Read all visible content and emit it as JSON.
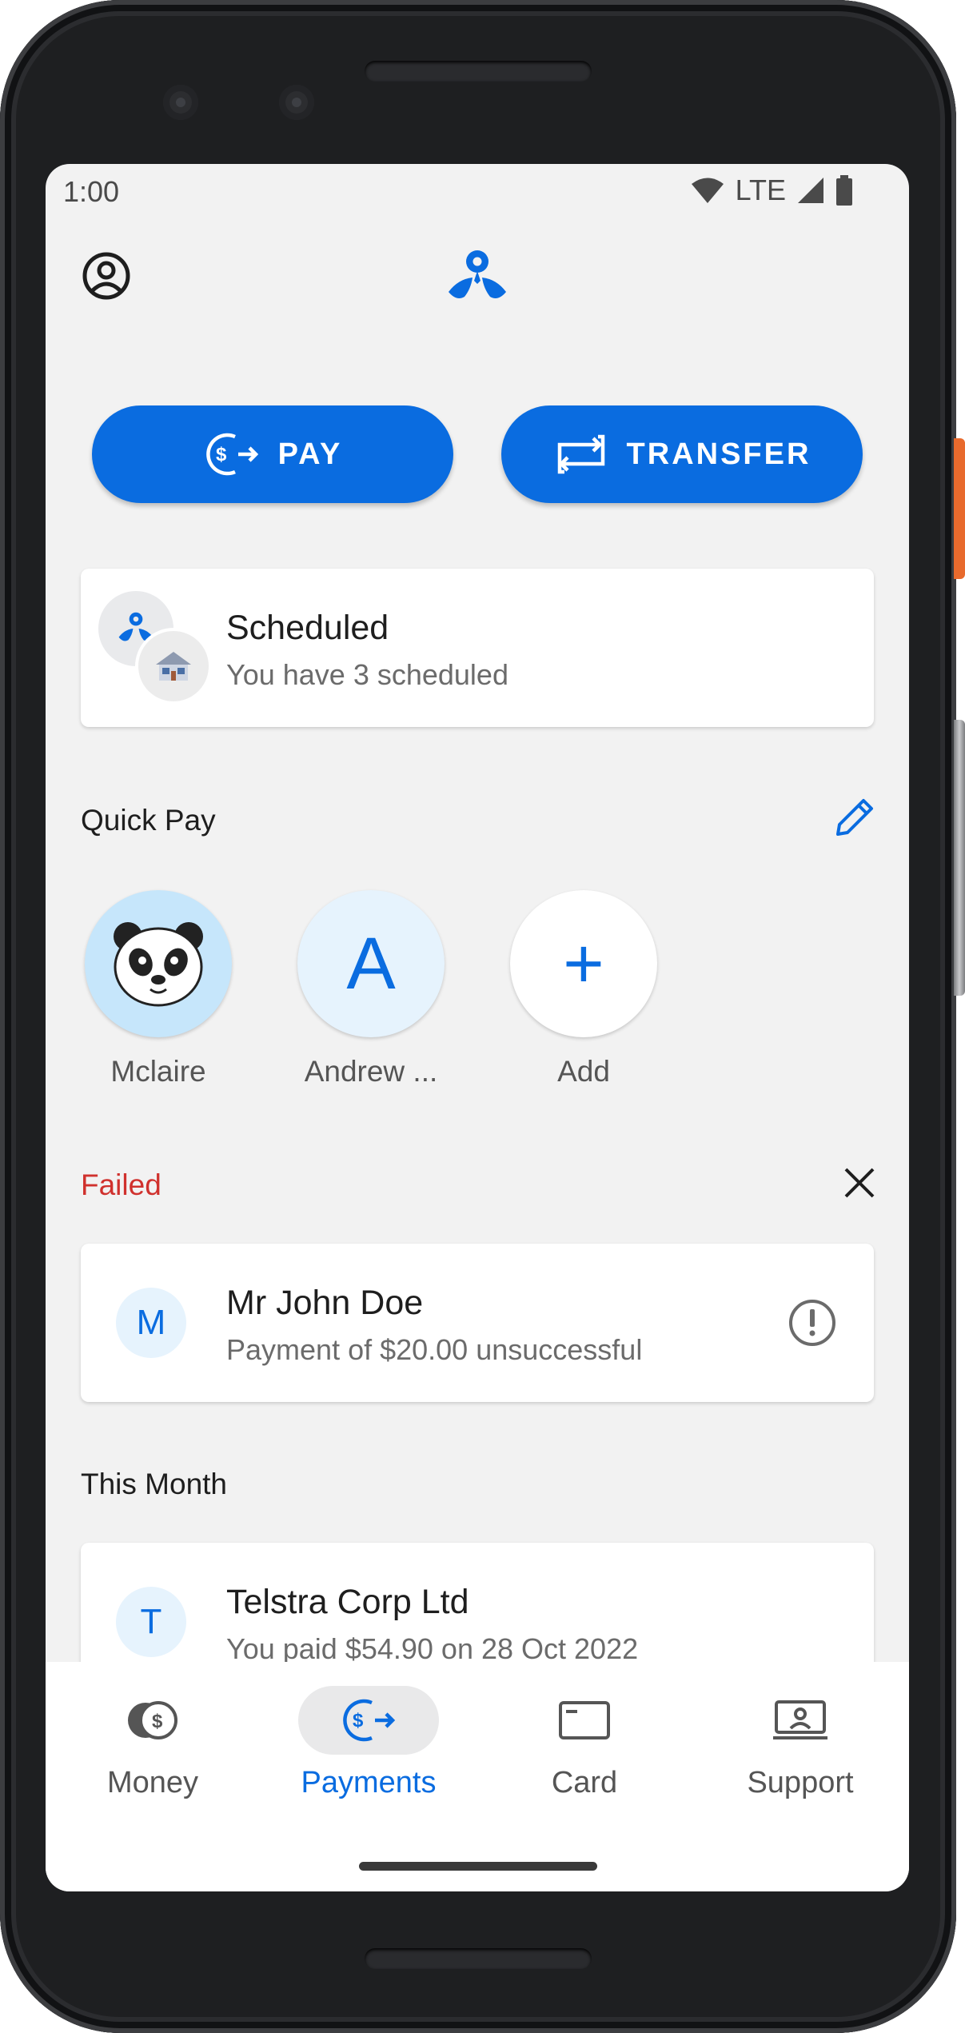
{
  "status_bar": {
    "time": "1:00",
    "network": "LTE",
    "icons": [
      "wifi-icon",
      "cell-signal-icon",
      "battery-icon"
    ]
  },
  "header": {
    "profile_icon": "account-circle-icon",
    "logo": "bank-logo"
  },
  "actions": {
    "pay_label": "PAY",
    "pay_icon": "payment-arrow-icon",
    "transfer_label": "TRANSFER",
    "transfer_icon": "transfer-arrows-icon"
  },
  "scheduled": {
    "title": "Scheduled",
    "subtitle": "You have 3 scheduled"
  },
  "quick_pay": {
    "title": "Quick Pay",
    "edit_icon": "pencil-icon",
    "items": [
      {
        "label": "Mclaire",
        "avatar": "🐼"
      },
      {
        "label": "Andrew ...",
        "avatar": "A"
      },
      {
        "label": "Add",
        "avatar": "+"
      }
    ]
  },
  "failed": {
    "title": "Failed",
    "close_icon": "close-icon",
    "items": [
      {
        "initial": "M",
        "name": "Mr John Doe",
        "detail": "Payment of $20.00 unsuccessful",
        "status_icon": "alert-circle-icon"
      }
    ]
  },
  "this_month": {
    "title": "This Month",
    "items": [
      {
        "initial": "T",
        "name": "Telstra Corp Ltd",
        "detail": "You paid $54.90 on 28 Oct 2022"
      }
    ]
  },
  "bottom_nav": {
    "items": [
      {
        "label": "Money",
        "icon": "money-icon",
        "active": false
      },
      {
        "label": "Payments",
        "icon": "payments-icon",
        "active": true
      },
      {
        "label": "Card",
        "icon": "card-icon",
        "active": false
      },
      {
        "label": "Support",
        "icon": "support-icon",
        "active": false
      }
    ]
  },
  "colors": {
    "primary": "#0a6ce0",
    "error": "#d0312d",
    "background": "#f2f2f2",
    "surface": "#ffffff"
  }
}
